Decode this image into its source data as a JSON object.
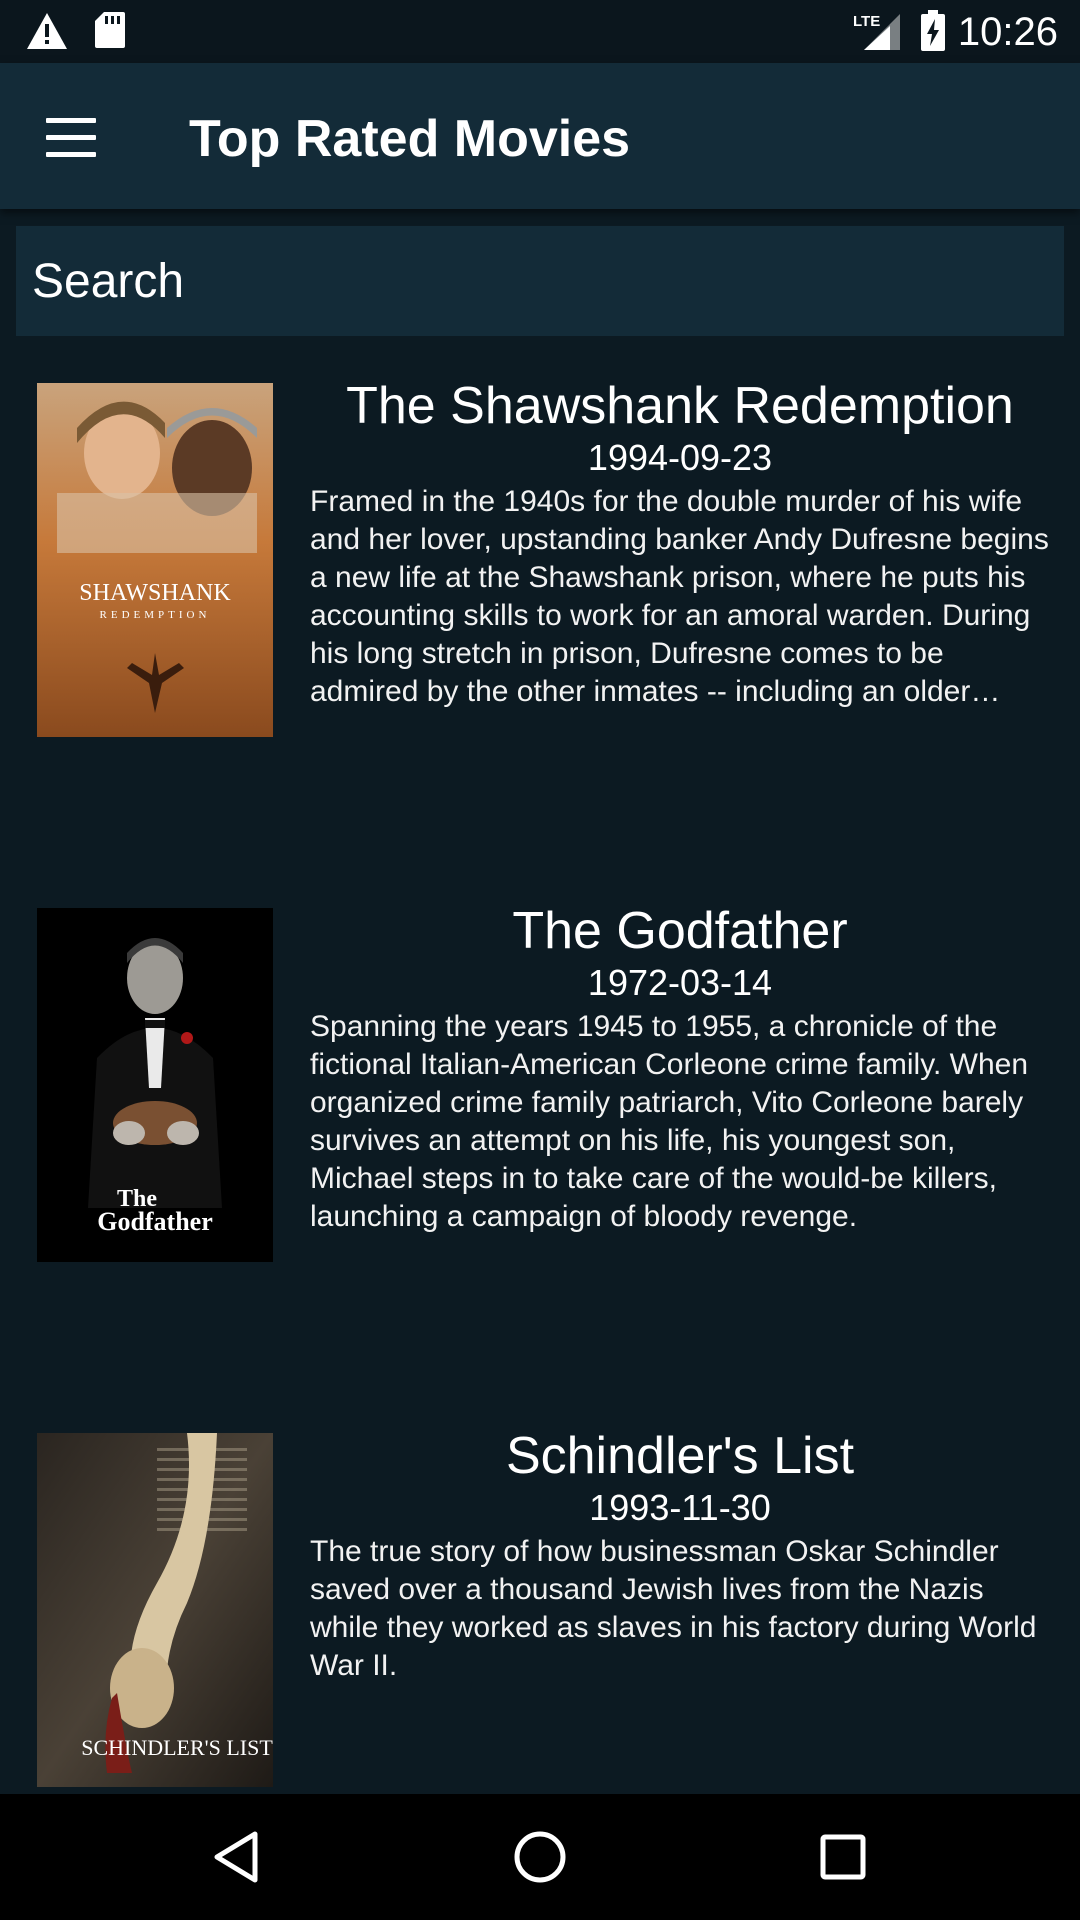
{
  "status_bar": {
    "left_icons": [
      "warning-icon",
      "sd-card-icon"
    ],
    "right_icons": [
      "lte-signal-icon",
      "battery-charging-icon"
    ],
    "network_label": "LTE",
    "time": "10:26"
  },
  "toolbar": {
    "menu_icon": "hamburger-menu-icon",
    "title": "Top Rated Movies"
  },
  "search": {
    "placeholder": "Search",
    "value": ""
  },
  "movies": [
    {
      "title": "The Shawshank Redemption",
      "date": "1994-09-23",
      "overview": "Framed in the 1940s for the double murder of his wife and her lover, upstanding banker Andy Dufresne begins a new life at the Shawshank prison, where he puts his accounting skills to work for an amoral warden. During his long stretch in prison, Dufresne comes to be admired by the other inmates -- including an older prisoner named Red -- for his integrity and unquenchable sense of hope.",
      "poster_text": "THE SHAWSHANK REDEMPTION"
    },
    {
      "title": "The Godfather",
      "date": "1972-03-14",
      "overview": "Spanning the years 1945 to 1955, a chronicle of the fictional Italian-American Corleone crime family. When organized crime family patriarch, Vito Corleone barely survives an attempt on his life, his youngest son, Michael steps in to take care of the would-be killers, launching a campaign of bloody revenge.",
      "poster_text": "The Godfather"
    },
    {
      "title": "Schindler's List",
      "date": "1993-11-30",
      "overview": "The true story of how businessman Oskar Schindler saved over a thousand Jewish lives from the Nazis while they worked as slaves in his factory during World War II.",
      "poster_text": "SCHINDLER'S LIST"
    }
  ],
  "nav_bar": {
    "icons": [
      "back-icon",
      "home-icon",
      "recents-icon"
    ]
  },
  "colors": {
    "background": "#0c1a22",
    "toolbar": "#132b38",
    "status_bar": "#0b161d",
    "nav_bar": "#000000"
  }
}
